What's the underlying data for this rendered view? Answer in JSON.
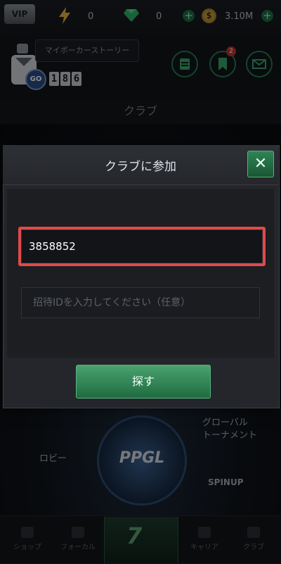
{
  "topbar": {
    "vip_label": "VIP",
    "energy_value": "0",
    "gems_value": "0",
    "coins_value": "3.10M",
    "coin_glyph": "$",
    "plus_glyph": "+"
  },
  "profile": {
    "story_button_label": "マイポーカーストーリー",
    "level_badge": "GO",
    "level_digits": [
      "1",
      "8",
      "6"
    ],
    "notification_count": "2"
  },
  "page": {
    "title": "クラブ"
  },
  "background": {
    "lobby_label": "ロビー",
    "global_tournament_label": "グローバル\nトーナメント",
    "spinup_label": "SPINUP",
    "ppgl_logo": "PPGL"
  },
  "modal": {
    "title": "クラブに参加",
    "close_glyph": "✕",
    "club_id_value": "3858852",
    "invite_placeholder": "招待IDを入力してください（任意）",
    "search_button_label": "探す"
  },
  "bottom_nav": {
    "items": [
      "ショップ",
      "フォーカル",
      "キャリア",
      "クラブ"
    ],
    "center_label": "7"
  },
  "colors": {
    "accent_green": "#2f8455",
    "highlight_red": "#e04a4a"
  }
}
